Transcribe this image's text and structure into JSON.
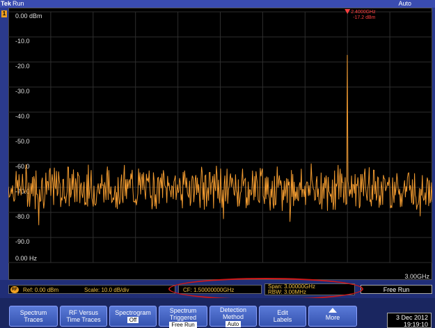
{
  "topbar": {
    "brand": "Tek",
    "run_state": "Run",
    "trigger_mode": "Auto"
  },
  "channel_tag": "1",
  "chart_data": {
    "type": "line",
    "title": "",
    "xlabel": "",
    "ylabel": "",
    "x_start_label": "0.00 Hz",
    "x_end_label": "3.00GHz",
    "xlim": [
      0,
      3.0
    ],
    "ylim": [
      -100,
      0
    ],
    "y_tick_labels": [
      "0.00 dBm",
      "-10.0",
      "-20.0",
      "-30.0",
      "-40.0",
      "-50.0",
      "-60.0",
      "-70.0",
      "-80.0",
      "-90.0"
    ],
    "y_ticks": [
      0,
      -10,
      -20,
      -30,
      -40,
      -50,
      -60,
      -70,
      -80,
      -90
    ],
    "grid": true,
    "trace_color": "#f09a30",
    "noise_floor_dbm": -70,
    "peak": {
      "x_ghz": 2.4,
      "y_dbm": -17.2
    },
    "marker": {
      "freq_label": "2.4000GHz",
      "level_label": "-17.2 dBm"
    }
  },
  "status": {
    "rf_badge": "RF",
    "ref": "Ref: 0.00 dBm",
    "scale": "Scale: 10.0 dB/div",
    "cf": "CF: 1.50000000GHz",
    "span": "Span:  3.00000GHz",
    "rbw": "RBW:   3.00MHz",
    "mode": "Free Run"
  },
  "menu": [
    {
      "line1": "Spectrum",
      "line2": "Traces",
      "sub": ""
    },
    {
      "line1": "RF Versus",
      "line2": "Time Traces",
      "sub": ""
    },
    {
      "line1": "Spectrogram",
      "line2": "",
      "sub": "Off"
    },
    {
      "line1": "Spectrum",
      "line2": "Triggered",
      "sub": "Free Run"
    },
    {
      "line1": "Detection",
      "line2": "Method",
      "sub": "Auto"
    },
    {
      "line1": "Edit",
      "line2": "Labels",
      "sub": ""
    },
    {
      "line1": "More",
      "line2": "",
      "sub": ""
    }
  ],
  "datetime": {
    "date": "3 Dec 2012",
    "time": "19:19:10"
  },
  "colors": {
    "frame": "#2b3a8c",
    "trace": "#f09a30",
    "marker": "#ff4040",
    "oval": "#d01818"
  }
}
